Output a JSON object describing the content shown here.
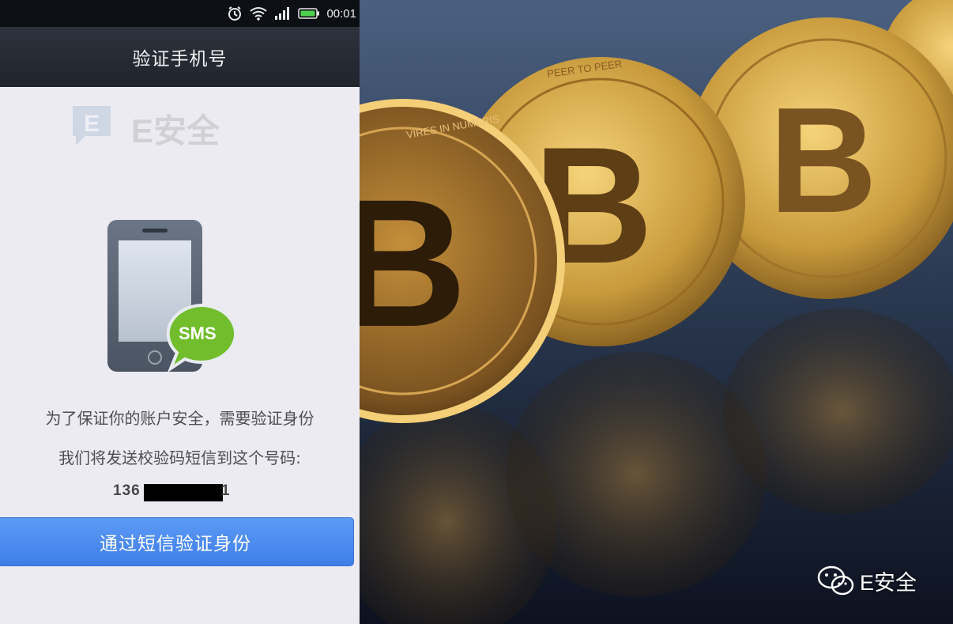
{
  "status_bar": {
    "time": "00:01"
  },
  "header": {
    "title": "验证手机号"
  },
  "watermark": {
    "text": "E安全"
  },
  "illustration": {
    "badge_label": "SMS"
  },
  "message": {
    "line1": "为了保证你的账户安全，需要验证身份",
    "line2": "我们将发送校验码短信到这个号码:"
  },
  "phone_number": {
    "visible_prefix": "136",
    "visible_suffix": "1"
  },
  "actions": {
    "sms_verify_label": "通过短信验证身份"
  },
  "photo": {
    "coins": [
      {
        "ring_text": "VIRES IN NUMERIS"
      },
      {
        "ring_text": "PEER TO PEER"
      }
    ]
  },
  "brand_badge": {
    "text": "E安全"
  },
  "colors": {
    "accent": "#4a8af0",
    "coin_gold": "#c89a3c",
    "background": "#ecebf1"
  }
}
